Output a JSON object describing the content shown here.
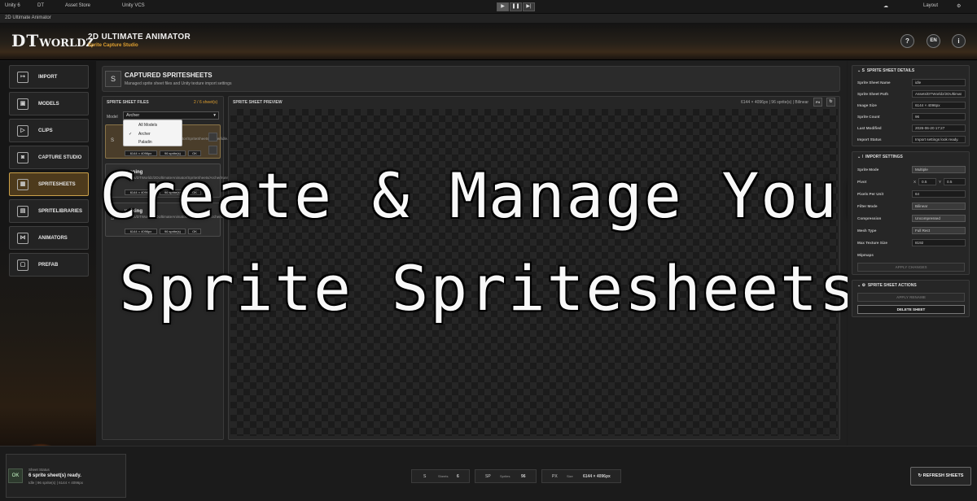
{
  "topbar": {
    "unity": "Unity 6",
    "account": "DT",
    "asset_store": "Asset Store",
    "vcs": "Unity VCS",
    "layout": "Layout"
  },
  "window_title": "2D Ultimate Animator",
  "header": {
    "logo_main": "DT",
    "logo_rest": "WORLDZ",
    "title": "2D ULTIMATE ANIMATOR",
    "subtitle": "Sprite Capture Studio",
    "help": "?",
    "lang": "EN",
    "info": "i"
  },
  "nav": [
    {
      "label": "IMPORT",
      "icon": "import-icon"
    },
    {
      "label": "MODELS",
      "icon": "models-icon"
    },
    {
      "label": "CLIPS",
      "icon": "clips-icon"
    },
    {
      "label": "CAPTURE STUDIO",
      "icon": "camera-icon"
    },
    {
      "label": "SPRITESHEETS",
      "icon": "grid-icon"
    },
    {
      "label": "SPRITELIBRARIES",
      "icon": "library-icon"
    },
    {
      "label": "ANIMATORS",
      "icon": "animator-icon"
    },
    {
      "label": "PREFAB",
      "icon": "prefab-icon"
    }
  ],
  "captured": {
    "badge": "S",
    "title": "CAPTURED SPRITESHEETS",
    "subtitle": "Managed sprite sheet files and Unity texture import settings"
  },
  "files": {
    "title": "SPRITE SHEET FILES",
    "count": "2 / 6 sheet(s)",
    "model_label": "Model",
    "model_value": "Archer",
    "dropdown": [
      "All Models",
      "Archer",
      "Paladin"
    ],
    "dropdown_check": "✓",
    "cards": [
      {
        "badge": "S",
        "name": "idle",
        "path": "Assets/DTWorldz/2DUltimateAnimator/SpriteSheets/Archer/idle.png",
        "size": "6144 × 4096px",
        "sprites": "96 sprite(s)",
        "ok": "OK"
      },
      {
        "badge": "S",
        "name": "running",
        "path": "Assets/DTWorldz/2DUltimateAnimator/SpriteSheets/Archer/running.png",
        "size": "6144 × 4096px",
        "sprites": "96 sprite(s)",
        "ok": "OK"
      },
      {
        "badge": "S",
        "name": "walking",
        "path": "Assets/DTWorldz/2DUltimateAnimator/SpriteSheets/Archer/walking.png",
        "size": "6144 × 4096px",
        "sprites": "96 sprite(s)",
        "ok": "OK"
      }
    ]
  },
  "preview": {
    "title": "SPRITE SHEET PREVIEW",
    "info": "6144 × 4096px | 96 sprite(s) | Bilinear",
    "fit": "Fit"
  },
  "overlay": {
    "line1": "Create & Manage Your",
    "line2": "Sprite Spritesheets"
  },
  "details": {
    "title": "SPRITE SHEET DETAILS",
    "rows": [
      {
        "label": "Sprite Sheet Name",
        "value": "idle"
      },
      {
        "label": "Sprite Sheet Path",
        "value": "Assets/DTWorldz/2DUltimat"
      },
      {
        "label": "Image Size",
        "value": "6144 × 4096px"
      },
      {
        "label": "Sprite Count",
        "value": "96"
      },
      {
        "label": "Last Modified",
        "value": "2026-06-20 17:27"
      },
      {
        "label": "Import Status",
        "value": "Import settings look ready."
      }
    ]
  },
  "import": {
    "title": "IMPORT SETTINGS",
    "sprite_mode": {
      "label": "Sprite Mode",
      "value": "Multiple"
    },
    "pivot": {
      "label": "Pivot",
      "x_label": "X",
      "x": "0.5",
      "y_label": "Y",
      "y": "0.5"
    },
    "ppu": {
      "label": "Pixels Per Unit",
      "value": "64"
    },
    "filter": {
      "label": "Filter Mode",
      "value": "Bilinear"
    },
    "compression": {
      "label": "Compression",
      "value": "Uncompressed"
    },
    "mesh": {
      "label": "Mesh Type",
      "value": "Full Rect"
    },
    "max_size": {
      "label": "Max Texture Size",
      "value": "8192"
    },
    "mipmaps": {
      "label": "Mipmaps"
    },
    "apply_button": "APPLY CHANGES"
  },
  "actions": {
    "title": "SPRITE SHEET ACTIONS",
    "apply": "APPLY RENAME",
    "delete": "DELETE SHEET"
  },
  "footer": {
    "status_label": "Sheet Status",
    "status_ok": "OK",
    "status_text": "6 sprite sheet(s) ready.",
    "status_sub": "Idle | 96 sprite(s) | 6144 × 4096px",
    "stats": [
      {
        "badge": "S",
        "label": "Sheets",
        "value": "6"
      },
      {
        "badge": "SP",
        "label": "Sprites",
        "value": "96"
      },
      {
        "badge": "PX",
        "label": "Size",
        "value": "6144 × 4096px"
      }
    ],
    "refresh": "REFRESH SHEETS"
  },
  "colors": {
    "accent": "#e0a030",
    "active_nav": "#4d3a1c"
  }
}
